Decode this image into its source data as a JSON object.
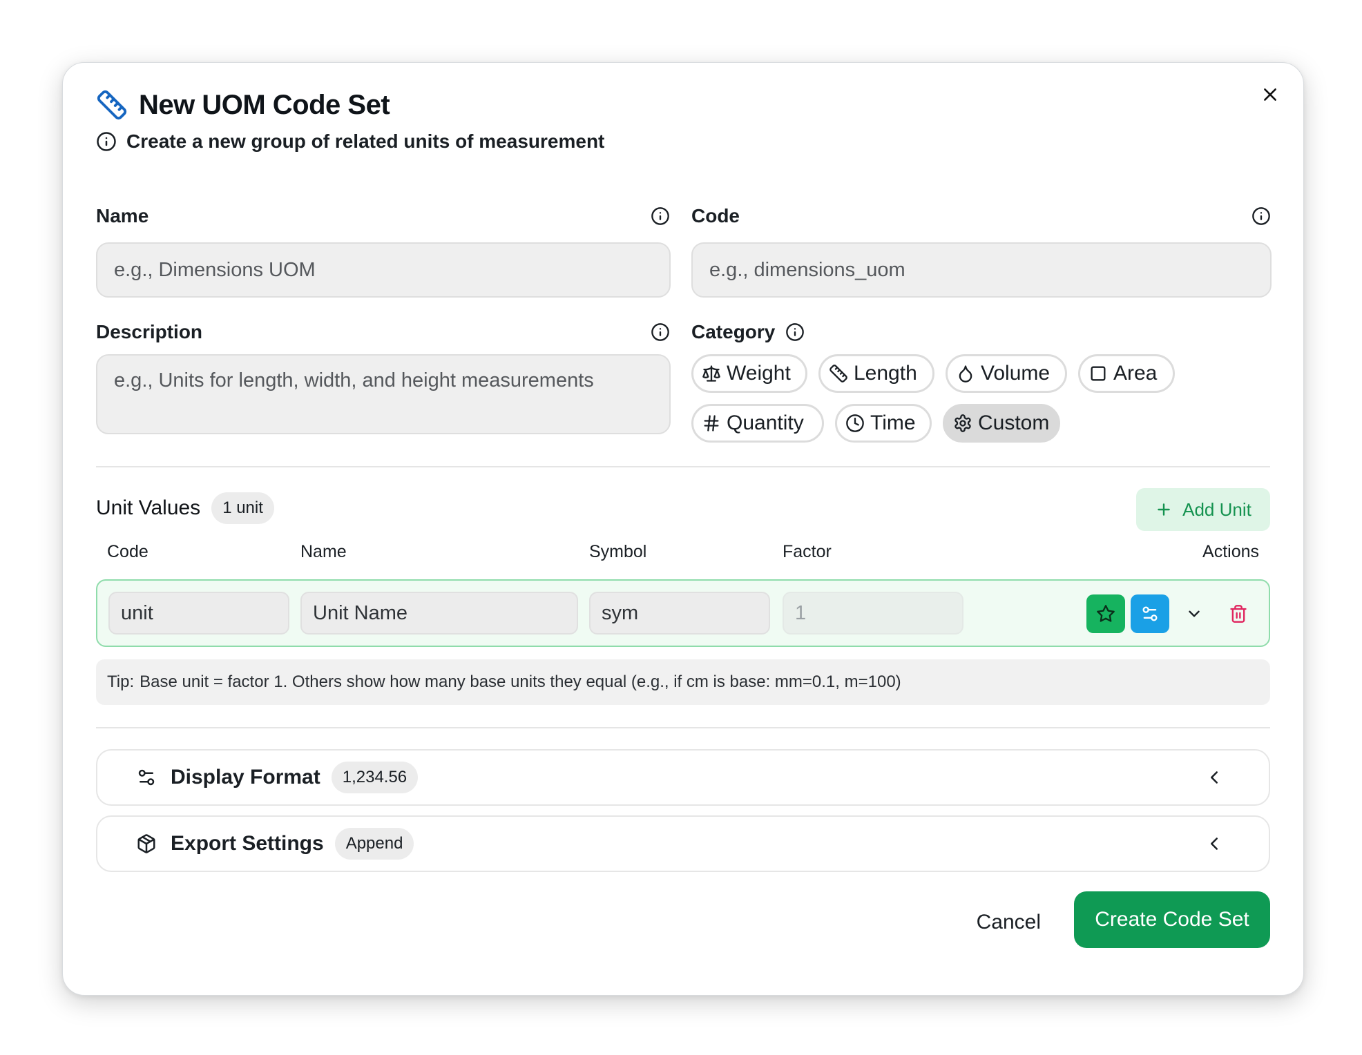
{
  "dialog": {
    "title": "New UOM Code Set",
    "subtitle": "Create a new group of related units of measurement"
  },
  "form": {
    "name": {
      "label": "Name",
      "placeholder": "e.g., Dimensions UOM"
    },
    "code": {
      "label": "Code",
      "placeholder": "e.g., dimensions_uom"
    },
    "description": {
      "label": "Description",
      "placeholder": "e.g., Units for length, width, and height measurements"
    },
    "category": {
      "label": "Category",
      "options": [
        {
          "label": "Weight",
          "icon": "scale-icon"
        },
        {
          "label": "Length",
          "icon": "ruler-icon"
        },
        {
          "label": "Volume",
          "icon": "droplet-icon"
        },
        {
          "label": "Area",
          "icon": "square-icon"
        },
        {
          "label": "Quantity",
          "icon": "hash-icon"
        },
        {
          "label": "Time",
          "icon": "clock-icon"
        },
        {
          "label": "Custom",
          "icon": "gear-icon"
        }
      ],
      "selected": "Custom"
    }
  },
  "units": {
    "title": "Unit Values",
    "count_badge": "1 unit",
    "add_label": "Add Unit",
    "columns": [
      "Code",
      "Name",
      "Symbol",
      "Factor",
      "Actions"
    ],
    "rows": [
      {
        "code": "unit",
        "name": "Unit Name",
        "symbol": "sym",
        "factor": "1"
      }
    ],
    "tip_label": "Tip:",
    "tip_text": "Base unit = factor 1. Others show how many base units they equal (e.g., if cm is base: mm=0.1, m=100)"
  },
  "sections": [
    {
      "title": "Display Format",
      "badge": "1,234.56",
      "icon": "sliders-icon"
    },
    {
      "title": "Export Settings",
      "badge": "Append",
      "icon": "package-icon"
    }
  ],
  "footer": {
    "cancel_label": "Cancel",
    "create_label": "Create Code Set"
  },
  "colors": {
    "accent_green": "#0f9a54",
    "star_button": "#16b35f",
    "config_button": "#1aa0e6",
    "delete_icon": "#e0245e",
    "ruler_icon": "#1565c0"
  }
}
